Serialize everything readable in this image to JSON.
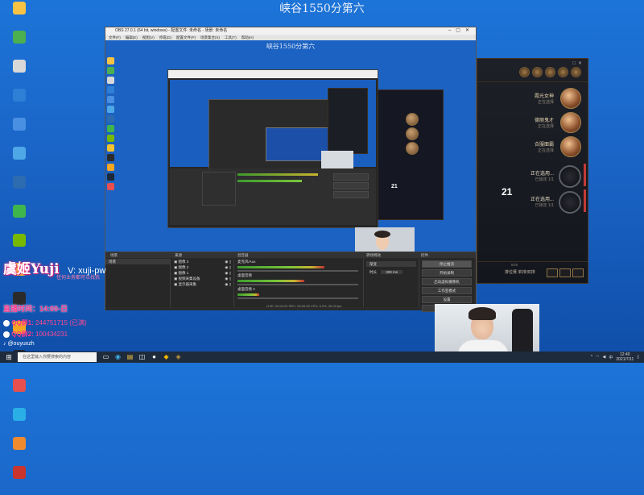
{
  "desktop": {
    "title": "峡谷1550分第六",
    "icons": [
      {
        "label": "",
        "color": "#f6c344"
      },
      {
        "label": "",
        "color": "#4caf50"
      },
      {
        "label": "",
        "color": "#d8d8d8"
      },
      {
        "label": "",
        "color": "#2e7fd6"
      },
      {
        "label": "",
        "color": "#4a90e2"
      },
      {
        "label": "",
        "color": "#4ea7e6"
      },
      {
        "label": "",
        "color": "#2c6bb0"
      },
      {
        "label": "",
        "color": "#3fb64b"
      },
      {
        "label": "",
        "color": "#76b900"
      },
      {
        "label": "",
        "color": "#f2c230"
      },
      {
        "label": "",
        "color": "#2b2b2b"
      },
      {
        "label": "",
        "color": "#f5a623"
      },
      {
        "label": "",
        "color": "#1b2838"
      },
      {
        "label": "",
        "color": "#e84f4f"
      },
      {
        "label": "",
        "color": "#2ab0e6"
      },
      {
        "label": "",
        "color": "#f08a2f"
      },
      {
        "label": "",
        "color": "#c9352c"
      }
    ]
  },
  "obs": {
    "window_title": "OBS 27.0.1 (64 bit, windows) - 配置文件: 未命名 - 场景: 未命名",
    "menu": [
      "文件(F)",
      "编辑(E)",
      "视图(V)",
      "停靠(D)",
      "配置文件(P)",
      "场景集合(S)",
      "工具(T)",
      "帮助(H)"
    ],
    "inner_title": "峡谷1550分第六",
    "docks": [
      "场景",
      "来源",
      "混音器",
      "转场特效",
      "控件"
    ],
    "scenes": [
      "场景"
    ],
    "sources": [
      "图像 3",
      "图像 2",
      "图像 1",
      "视频采集设备",
      "显示器采集"
    ],
    "mixer": [
      {
        "label": "麦克风/Aux",
        "level": 0.72
      },
      {
        "label": "桌面音频",
        "level": 0.55
      },
      {
        "label": "桌面音频 2",
        "level": 0.18
      }
    ],
    "transition": {
      "label": "渐变",
      "duration_label": "时长",
      "duration": "300 ms"
    },
    "controls": [
      "停止推流",
      "开始录制",
      "启动虚拟摄像机",
      "工作室模式",
      "设置",
      "退出"
    ],
    "status": "LIVE: 02:04:22   REC: 00:00:00   CPU: 6.3%, 30.00 fps"
  },
  "lol": {
    "champions": [
      {
        "name": "霞光女神",
        "sub": "正在选择"
      },
      {
        "name": "德丽鬼才",
        "sub": "正在选择"
      },
      {
        "name": "合服面霸",
        "sub": "正在选择"
      }
    ],
    "picking": [
      {
        "name": "正在选用...",
        "sub": "已锁定 1/1"
      },
      {
        "name": "正在选用...",
        "sub": "已锁定 1/1"
      }
    ],
    "timer": "21",
    "vs": "5V5",
    "mode": "排位赛 单排/双排"
  },
  "overlay": {
    "name": "虞姬Yuji",
    "wechat": "V: xuji-pw",
    "subtitle": "任何业务都可以找我",
    "live_time": "直播时间：14:00-日",
    "qq1_label": "QQ群1:",
    "qq1_value": "244751715 (已满)",
    "qq2_label": "QQ群2:",
    "qq2_value": "100434231",
    "douyin": "@ouyuxzh"
  },
  "taskbar": {
    "search_placeholder": "在这里输入你要搜索的内容",
    "time": "12:40",
    "date": "2021/7/11",
    "lang": "中"
  },
  "colors": {
    "desktop_blue": "#1a64c6",
    "obs_dark": "#2b2b2b",
    "lol_gold": "#a7834a",
    "overlay_pink": "#ff3a8a",
    "pick_red": "#c23b37"
  }
}
